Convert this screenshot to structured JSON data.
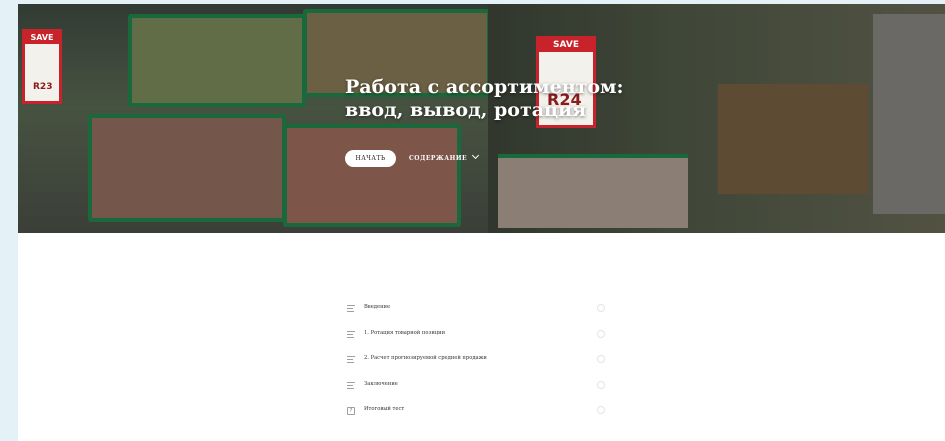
{
  "hero": {
    "title_line1": "Работа с ассортиментом:",
    "title_line2": "ввод, вывод, ротация",
    "start_label": "НАЧАТЬ",
    "contents_label": "СОДЕРЖАНИЕ",
    "sign_left": {
      "top": "SAVE",
      "price": "R23"
    },
    "sign_right": {
      "top": "SAVE",
      "price": "R24"
    }
  },
  "lessons": [
    {
      "label": "Введение",
      "icon": "lines-icon"
    },
    {
      "label": "1. Ротация товарной позиции",
      "icon": "lines-icon"
    },
    {
      "label": "2. Расчет прогнозируемой средней продажи",
      "icon": "lines-icon"
    },
    {
      "label": "Заключение",
      "icon": "lines-icon"
    },
    {
      "label": "Итоговый тест",
      "icon": "quiz-icon"
    }
  ],
  "colors": {
    "brand_green": "#1c8a4c",
    "sale_red": "#c8222b",
    "background": "#e4f1f7"
  }
}
